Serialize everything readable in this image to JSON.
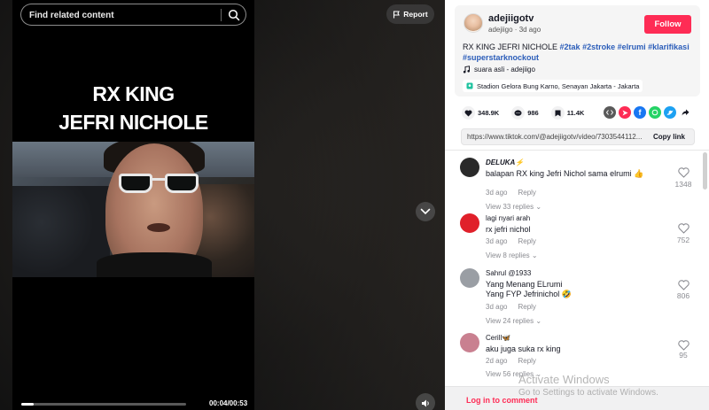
{
  "search": {
    "placeholder": "Find related content"
  },
  "report_label": "Report",
  "video": {
    "title_line1": "RX KING",
    "title_line2": "JEFRI NICHOLE",
    "time": "00:04/00:53",
    "progress": 0.075
  },
  "author": {
    "name": "adejiigotv",
    "handle": "adejiigo",
    "age": "3d ago",
    "follow_label": "Follow"
  },
  "description": {
    "text": "RX KING JEFRI NICHOLE ",
    "hashtags": [
      "#2tak",
      "#2stroke",
      "#elrumi",
      "#klarifikasi",
      "#superstarknockout"
    ]
  },
  "music": "suara asli - adejiigo",
  "location": "Stadion Gelora Bung Karno, Senayan Jakarta - Jakarta",
  "stats": {
    "likes": "348.9K",
    "comments": "986",
    "saves": "11.4K"
  },
  "link": {
    "url": "https://www.tiktok.com/@adejiigotv/video/7303544112...",
    "copy_label": "Copy link"
  },
  "comments": [
    {
      "name": "DELUKA⚡",
      "text": "balapan RX king Jefri Nichol sama elrumi 👍",
      "date": "3d ago",
      "reply": "Reply",
      "views": "View 33 replies",
      "likes": "1348",
      "avatar_color": "#2a2a2a"
    },
    {
      "name": "lagi nyari arah",
      "text": "rx jefri nichol",
      "date": "3d ago",
      "reply": "Reply",
      "views": "View 8 replies",
      "likes": "752",
      "avatar_color": "#e0202a"
    },
    {
      "name": "Sahrul @1933",
      "text": "Yang Menang ELrumi",
      "text2": "Yang FYP Jefrinichol 🤣",
      "date": "3d ago",
      "reply": "Reply",
      "views": "View 24 replies",
      "likes": "806",
      "avatar_color": "#9a9ea4"
    },
    {
      "name": "Cerill🦋",
      "text": "aku juga suka rx king",
      "date": "2d ago",
      "reply": "Reply",
      "views": "View 56 replies",
      "likes": "95",
      "avatar_color": "#c98090"
    }
  ],
  "login_label": "Log in to comment",
  "watermark": {
    "line1": "Activate Windows",
    "line2": "Go to Settings to activate Windows."
  }
}
